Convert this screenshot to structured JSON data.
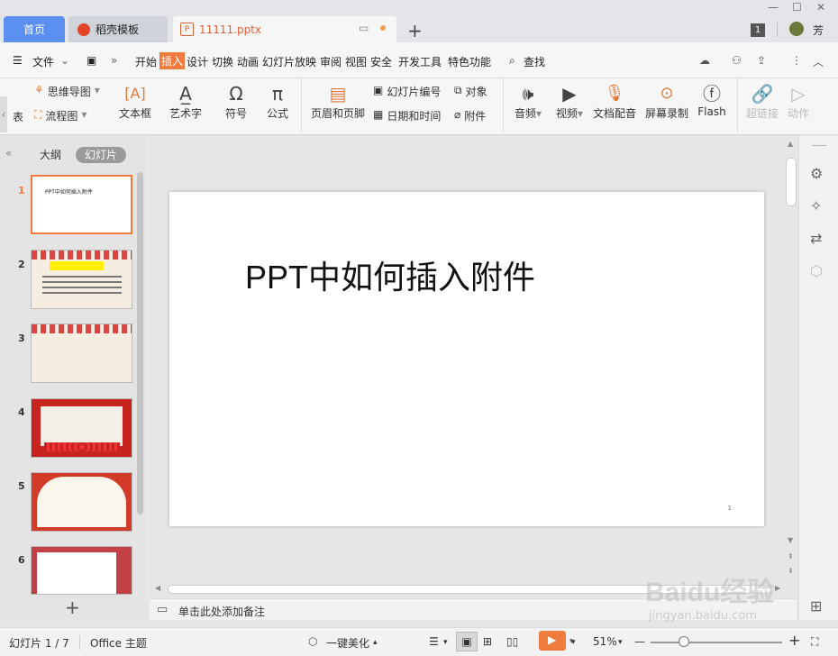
{
  "tabs": {
    "home": "首页",
    "daoke": "稻壳模板",
    "file": "11111.pptx",
    "add": "+"
  },
  "user": {
    "badge": "1",
    "name": "芳"
  },
  "menu": {
    "file": "文件",
    "items": [
      "开始",
      "插入",
      "设计",
      "切换",
      "动画",
      "幻灯片放映",
      "审阅",
      "视图",
      "安全",
      "开发工具",
      "特色功能"
    ],
    "search": "查找"
  },
  "ribbon": {
    "table_partial": "表",
    "mindmap": "思维导图",
    "flowchart": "流程图",
    "textbox": "文本框",
    "wordart": "艺术字",
    "symbol": "符号",
    "formula": "公式",
    "header_footer": "页眉和页脚",
    "slide_number": "幻灯片编号",
    "object": "对象",
    "datetime": "日期和时间",
    "attachment": "附件",
    "audio": "音频",
    "video": "视频",
    "doc_dub": "文档配音",
    "screen_rec": "屏幕录制",
    "flash": "Flash",
    "hyperlink": "超链接",
    "action": "动作"
  },
  "left_panel": {
    "outline": "大纲",
    "slides": "幻灯片",
    "slide_numbers": [
      "1",
      "2",
      "3",
      "4",
      "5",
      "6"
    ],
    "thumb1_text": "PPT中如何插入附件",
    "add": "+"
  },
  "slide": {
    "title": "PPT中如何插入附件",
    "page_number": "1"
  },
  "notes": {
    "placeholder": "单击此处添加备注"
  },
  "status": {
    "slide_info": "幻灯片 1 / 7",
    "theme": "Office 主题",
    "beautify": "一键美化",
    "zoom": "51%"
  },
  "watermark": {
    "text": "Baidu经验",
    "url": "jingyan.baidu.com"
  },
  "colors": {
    "accent": "#f07b3f",
    "home_tab": "#5b8ff0"
  }
}
